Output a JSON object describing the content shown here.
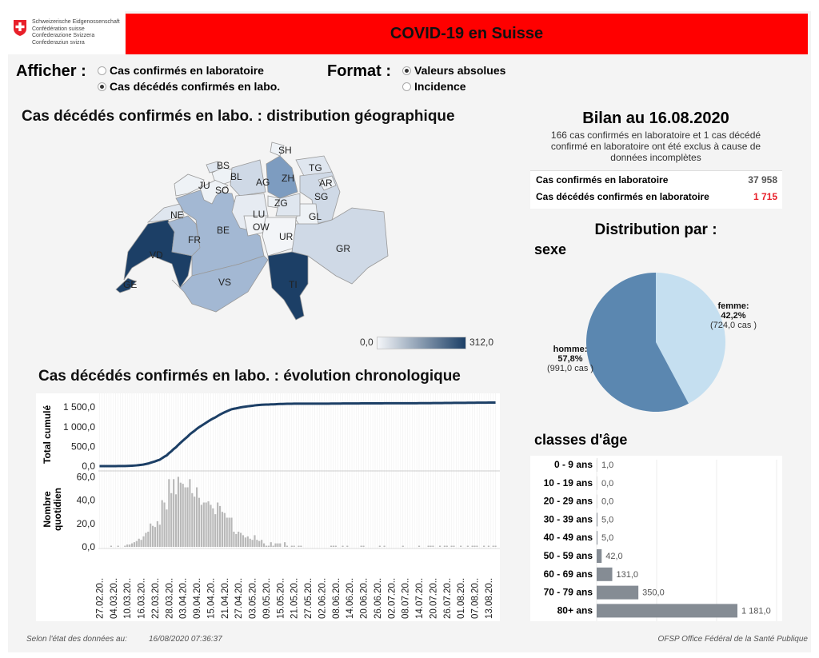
{
  "header": {
    "logo_lines": [
      "Schweizerische Eidgenossenschaft",
      "Confédération suisse",
      "Confederazione Svizzera",
      "Confederaziun svizra"
    ],
    "title": "COVID-19 en Suisse",
    "brand_color": "#ff0000"
  },
  "controls": {
    "afficher_label": "Afficher :",
    "afficher_options": [
      {
        "label": "Cas confirmés en laboratoire",
        "selected": false
      },
      {
        "label": "Cas décédés confirmés en labo.",
        "selected": true
      }
    ],
    "format_label": "Format :",
    "format_options": [
      {
        "label": "Valeurs absolues",
        "selected": true
      },
      {
        "label": "Incidence",
        "selected": false
      }
    ]
  },
  "map": {
    "title": "Cas décédés confirmés en labo. : distribution géographique",
    "legend_min": "0,0",
    "legend_max": "312,0",
    "cantons": [
      {
        "id": "GE",
        "color": "#1c3f66"
      },
      {
        "id": "VD",
        "color": "#1c3f66"
      },
      {
        "id": "NE",
        "color": "#dfe6ef"
      },
      {
        "id": "JU",
        "color": "#eef2f6"
      },
      {
        "id": "FR",
        "color": "#a3b8d3"
      },
      {
        "id": "BE",
        "color": "#a3b8d3"
      },
      {
        "id": "SO",
        "color": "#eef2f6"
      },
      {
        "id": "BS",
        "color": "#dfe6ef"
      },
      {
        "id": "BL",
        "color": "#eef2f6"
      },
      {
        "id": "AG",
        "color": "#cfd9e6"
      },
      {
        "id": "ZH",
        "color": "#7d9cc0"
      },
      {
        "id": "SH",
        "color": "#eef2f6"
      },
      {
        "id": "TG",
        "color": "#dfe6ef"
      },
      {
        "id": "SG",
        "color": "#cfd9e6"
      },
      {
        "id": "AR",
        "color": "#eef2f6"
      },
      {
        "id": "GL",
        "color": "#eef2f6"
      },
      {
        "id": "ZG",
        "color": "#eef2f6"
      },
      {
        "id": "LU",
        "color": "#e6ebf2"
      },
      {
        "id": "OW",
        "color": "#f3f5f8"
      },
      {
        "id": "SZ",
        "color": "#dfe6ef"
      },
      {
        "id": "UR",
        "color": "#f3f5f8"
      },
      {
        "id": "GR",
        "color": "#cfd9e6"
      },
      {
        "id": "TI",
        "color": "#1c3f66"
      },
      {
        "id": "VS",
        "color": "#a3b8d3"
      }
    ]
  },
  "bilan": {
    "title": "Bilan au 16.08.2020",
    "note": "166 cas confirmés en laboratoire et 1 cas décédé confirmé en laboratoire ont été exclus à cause de données incomplètes",
    "rows": [
      {
        "label": "Cas confirmés en laboratoire",
        "value": "37 958",
        "color": "#555555"
      },
      {
        "label": "Cas décédés confirmés en laboratoire",
        "value": "1 715",
        "color": "#e8202a"
      }
    ]
  },
  "distribution": {
    "title": "Distribution par :",
    "sexe_title": "sexe",
    "age_title": "classes d'âge"
  },
  "chart_data": [
    {
      "type": "line",
      "title": "Cas décédés confirmés en labo. : évolution chronologique",
      "ylabel": "Total cumulé",
      "yticks": [
        "0,0",
        "500,0",
        "1 000,0",
        "1 500,0"
      ],
      "ylim": [
        0,
        1850
      ],
      "color": "#1c3f66"
    },
    {
      "type": "bar",
      "ylabel": "Nombre quotidien",
      "yticks": [
        "0,0",
        "20,0",
        "40,0",
        "60,0"
      ],
      "ylim": [
        0,
        63
      ],
      "color": "#b8b8b8",
      "x_start": "27.02.2020",
      "x_end": "16.08.2020",
      "xticks": [
        "27.02.20..",
        "04.03.20..",
        "10.03.20..",
        "16.03.20..",
        "22.03.20..",
        "28.03.20..",
        "03.04.20..",
        "09.04.20..",
        "15.04.20..",
        "21.04.20..",
        "27.04.20..",
        "03.05.20..",
        "09.05.20..",
        "15.05.20..",
        "21.05.20..",
        "27.05.20..",
        "02.06.20..",
        "08.06.20..",
        "14.06.20..",
        "20.06.20..",
        "26.06.20..",
        "02.07.20..",
        "08.07.20..",
        "14.07.20..",
        "20.07.20..",
        "26.07.20..",
        "01.08.20..",
        "07.08.20..",
        "13.08.20.."
      ],
      "values": [
        0,
        0,
        0,
        0,
        0,
        1,
        0,
        0,
        1,
        0,
        0,
        1,
        2,
        2,
        3,
        4,
        5,
        7,
        6,
        9,
        12,
        13,
        20,
        18,
        17,
        22,
        19,
        40,
        38,
        32,
        58,
        46,
        58,
        45,
        60,
        55,
        54,
        51,
        51,
        58,
        46,
        43,
        51,
        42,
        36,
        38,
        38,
        39,
        36,
        33,
        28,
        38,
        35,
        30,
        29,
        25,
        25,
        25,
        13,
        11,
        13,
        12,
        10,
        8,
        9,
        7,
        6,
        10,
        6,
        5,
        6,
        3,
        1,
        1,
        4,
        1,
        3,
        3,
        3,
        0,
        4,
        1,
        0,
        1,
        1,
        0,
        1,
        1,
        0,
        0,
        0,
        0,
        0,
        0,
        0,
        0,
        0,
        0,
        0,
        0,
        1,
        1,
        1,
        0,
        0,
        1,
        0,
        1,
        0,
        0,
        0,
        0,
        0,
        1,
        1,
        0,
        0,
        0,
        0,
        0,
        0,
        1,
        0,
        1,
        0,
        0,
        0,
        0,
        0,
        0,
        0,
        1,
        0,
        0,
        0,
        0,
        0,
        0,
        1,
        0,
        0,
        0,
        1,
        1,
        1,
        0,
        0,
        1,
        0,
        1,
        1,
        0,
        1,
        1,
        0,
        0,
        1,
        0,
        0,
        1,
        0,
        1,
        1,
        1,
        0,
        0,
        1,
        0,
        1,
        0,
        1,
        1
      ]
    },
    {
      "type": "pie",
      "slices": [
        {
          "name": "femme",
          "label": "femme:",
          "pct": "42,2%",
          "cas": "(724,0 cas )",
          "value": 42.2,
          "color": "#c5dff0"
        },
        {
          "name": "homme",
          "label": "homme:",
          "pct": "57,8%",
          "cas": "(991,0 cas )",
          "value": 57.8,
          "color": "#5b87b0"
        }
      ]
    },
    {
      "type": "bar",
      "orientation": "horizontal",
      "color": "#858c94",
      "categories": [
        "0 - 9 ans",
        "10 - 19 ans",
        "20 - 29 ans",
        "30 - 39 ans",
        "40 - 49 ans",
        "50 - 59 ans",
        "60 - 69 ans",
        "70 - 79 ans",
        "80+ ans"
      ],
      "values": [
        1,
        0,
        0,
        5,
        5,
        42,
        131,
        350,
        1181
      ],
      "labels": [
        "1,0",
        "0,0",
        "0,0",
        "5,0",
        "5,0",
        "42,0",
        "131,0",
        "350,0",
        "1 181,0"
      ]
    }
  ],
  "footer": {
    "state_label": "Selon l'état des données au:",
    "state_value": "16/08/2020 07:36:37",
    "source": "OFSP Office Fédéral de la Santé Publique"
  }
}
